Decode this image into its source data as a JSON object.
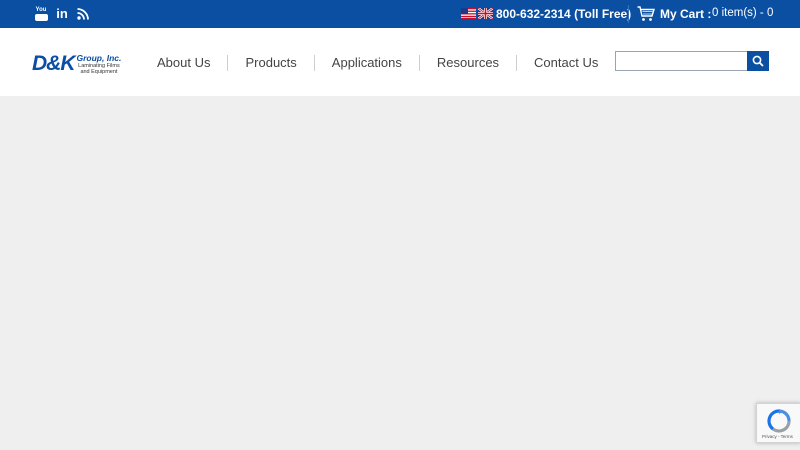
{
  "topbar": {
    "social": [
      {
        "name": "youtube-icon",
        "label": "You"
      },
      {
        "name": "linkedin-icon",
        "label": "in"
      },
      {
        "name": "rss-icon"
      }
    ],
    "phone": "800-632-2314 (Toll Free)",
    "cart_label": "My Cart :",
    "cart_count": "0 item(s) - 0"
  },
  "logo": {
    "mark": "D&K",
    "name": "Group, Inc.",
    "tagline_1": "Laminating Films",
    "tagline_2": "and Equipment"
  },
  "nav": {
    "items": [
      "About Us",
      "Products",
      "Applications",
      "Resources",
      "Contact Us"
    ]
  },
  "search": {
    "value": "",
    "placeholder": ""
  },
  "recaptcha": {
    "footer": "Privacy - Terms"
  },
  "colors": {
    "brand_blue": "#0b4fa3",
    "background": "#efefef"
  }
}
